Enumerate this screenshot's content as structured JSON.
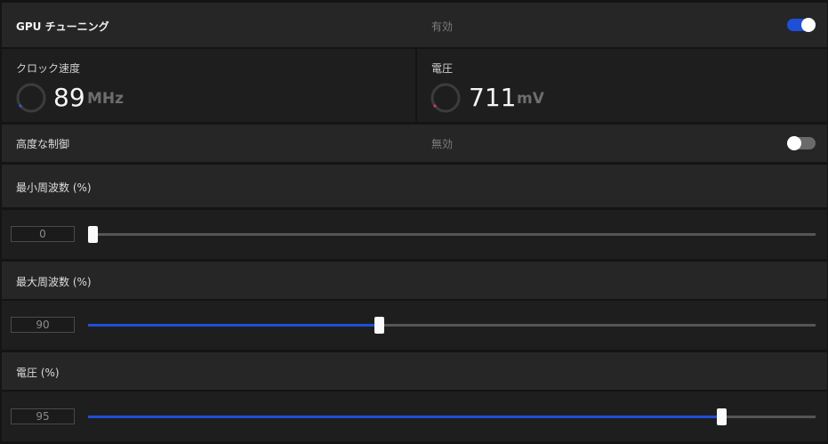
{
  "header": {
    "title": "GPU チューニング",
    "status_label": "有効",
    "toggle_on": true
  },
  "metrics": {
    "clock": {
      "label": "クロック速度",
      "value": "89",
      "unit": "MHz"
    },
    "voltage": {
      "label": "電圧",
      "value": "711",
      "unit": "mV"
    }
  },
  "advanced": {
    "label": "高度な制御",
    "status_label": "無効",
    "toggle_on": false
  },
  "sliders": [
    {
      "label": "最小周波数 (%)",
      "value": "0",
      "percent": 0
    },
    {
      "label": "最大周波数 (%)",
      "value": "90",
      "percent": 40
    },
    {
      "label": "電圧 (%)",
      "value": "95",
      "percent": 87
    }
  ],
  "colors": {
    "accent": "#1f4fd6",
    "toggle_off": "#6a6a6a",
    "clock_gauge_marker": "#2d5be3",
    "voltage_gauge_marker": "#d8334a"
  }
}
